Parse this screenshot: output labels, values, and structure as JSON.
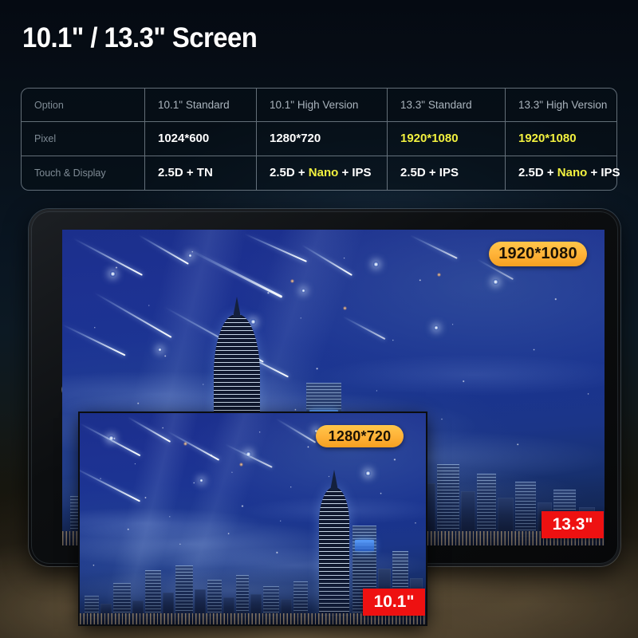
{
  "page": {
    "title": "10.1\" / 13.3\" Screen",
    "accent_yellow": "#f2f13f",
    "badge_orange": "#ffb43a",
    "badge_red": "#ee1111",
    "background_dark": "#05080e"
  },
  "spec_table": {
    "columns": [
      "Option",
      "10.1\" Standard",
      "10.1\" High Version",
      "13.3\" Standard",
      "13.3\" High Version"
    ],
    "rows": [
      {
        "label": "Pixel",
        "values": [
          "1024*600",
          "1280*720",
          "1920*1080",
          "1920*1080"
        ],
        "highlight": [
          false,
          false,
          true,
          true
        ]
      },
      {
        "label": "Touch & Display",
        "cells": [
          {
            "pre": "2.5D + TN",
            "nano": "",
            "post": ""
          },
          {
            "pre": "2.5D + ",
            "nano": "Nano",
            "post": " + IPS"
          },
          {
            "pre": "2.5D + IPS",
            "nano": "",
            "post": ""
          },
          {
            "pre": "2.5D + ",
            "nano": "Nano",
            "post": " + IPS"
          }
        ]
      }
    ]
  },
  "device": {
    "name": "tablet-device",
    "screens": [
      {
        "id": "screen-13",
        "size_label": "13.3\"",
        "resolution_label": "1920*1080"
      },
      {
        "id": "screen-10",
        "size_label": "10.1\"",
        "resolution_label": "1280*720"
      }
    ]
  },
  "badges": {
    "resolution_large": "1920*1080",
    "resolution_small": "1280*720",
    "size_large": "13.3\"",
    "size_small": "10.1\""
  }
}
